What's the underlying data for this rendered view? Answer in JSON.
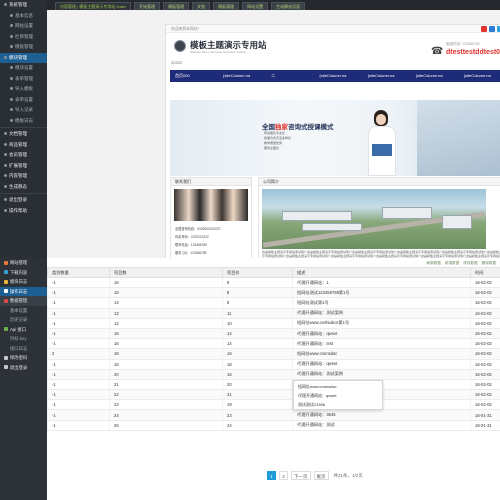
{
  "top_sidebar": {
    "items": [
      {
        "label": "系统管理",
        "kind": "group"
      },
      {
        "label": "基本信息",
        "kind": "sub"
      },
      {
        "label": "网站设置",
        "kind": "sub"
      },
      {
        "label": "栏目管理",
        "kind": "sub"
      },
      {
        "label": "模板管理",
        "kind": "sub"
      },
      {
        "label": "模块管理",
        "kind": "group active"
      },
      {
        "label": "模块设置",
        "kind": "sub"
      },
      {
        "label": "表单管理",
        "kind": "sub"
      },
      {
        "label": "导入模板",
        "kind": "sub"
      },
      {
        "label": "表单设置",
        "kind": "sub"
      },
      {
        "label": "导入记录",
        "kind": "sub"
      },
      {
        "label": "模板日志",
        "kind": "sub"
      },
      {
        "label": "",
        "kind": "sep"
      },
      {
        "label": "文档管理",
        "kind": "group"
      },
      {
        "label": "商品管理",
        "kind": "group"
      },
      {
        "label": "会员管理",
        "kind": "group"
      },
      {
        "label": "扩展管理",
        "kind": "group"
      },
      {
        "label": "内容管理",
        "kind": "group"
      },
      {
        "label": "生成静态",
        "kind": "group"
      },
      {
        "label": "",
        "kind": "sep"
      },
      {
        "label": "退出登录",
        "kind": "group"
      },
      {
        "label": "操作帮助",
        "kind": "group"
      }
    ]
  },
  "topbar": {
    "tabs": [
      "内容管理 | 模板主题演示专用站 Index",
      "开始管理",
      "模板管理",
      "文档",
      "模板管理",
      "网站设置",
      "生成静态页面"
    ]
  },
  "site": {
    "welcome": "欢迎来到本网站！",
    "logo_title": "模板主题演示专用站",
    "logo_sub": "Website Demo Template Exclusive Station",
    "hotline_label": "客服热线: 123456789",
    "hotline_number": "dtesttestddtest000",
    "code": "22222",
    "nav": [
      "首页000",
      "{siteColumn.na",
      "二",
      "{siteColumn.na",
      "{siteColumn.na",
      "{siteColumn.na",
      "{siteColumn.na"
    ],
    "banner": {
      "headline_prefix": "全国",
      "headline_highlight": "独家",
      "headline_suffix": "咨询式授课模式",
      "bullets": [
        "师资团队专业化",
        "授课方式灵活多样化",
        "教学质量优秀",
        "服务全面化"
      ]
    },
    "left_panel": {
      "title": "联系我们",
      "lines": [
        "全国咨询热线：0000000222222",
        "传真号码：2222222222",
        "联系电话：123456789",
        "服务 QQ：123456789",
        "电子邮箱：123456789@qq.com"
      ]
    },
    "right_panel": {
      "title": "公司简介",
      "text": "这是模板主题演示专用站测试简介这是模板主题演示专用站测试简介这是模板主题演示专用站测试简介这是模板主题演示专用站测试简介这是模板主题演示专用站测试简介这是模板主题演示专用站测试简介这是模板主题演示专用站测试简介这是模板主题演示专用站测试简介这是模板主题演示专用站测试简介这是模板主题演示专用站测试简介这是模板主题演示专用站测试简介这是模板主题演示专用站测试简介这是模板主题演示专用站测试简介这是模板主题演示专用站测试简介"
    }
  },
  "low_sidebar": {
    "items": [
      {
        "label": "网站管理",
        "kind": "group"
      },
      {
        "label": "下载内容",
        "kind": "group"
      },
      {
        "label": "模块日志",
        "kind": "group"
      },
      {
        "label": "操作日志",
        "kind": "active"
      },
      {
        "label": "数据管理",
        "kind": "group hover"
      },
      {
        "label": "基本设置",
        "kind": "sub"
      },
      {
        "label": "历史记录",
        "kind": "sub"
      },
      {
        "label": "Api 接口",
        "kind": "group"
      },
      {
        "label": "目标 key",
        "kind": "sub"
      },
      {
        "label": "接口日志",
        "kind": "sub"
      },
      {
        "label": "修改密码",
        "kind": "group"
      },
      {
        "label": "退出登录",
        "kind": "group"
      }
    ]
  },
  "toolbar": [
    "刷新数据",
    "新增数据",
    "修改数据",
    "删除数据"
  ],
  "table": {
    "headers": [
      "类别数量",
      "项目数",
      "项目价",
      "描述",
      "时间"
    ],
    "rows": [
      [
        "-1",
        "16",
        "9",
        "代理开通网站：1",
        "16-02-02"
      ],
      [
        "-1",
        "15",
        "8",
        "短网址测试123456789第1号",
        "16-02-02"
      ],
      [
        "-1",
        "14",
        "6",
        "短网址测试第1号",
        "16-02-02"
      ],
      [
        "-1",
        "13",
        "11",
        "代理开通网站：测试案例",
        "16-02-02"
      ],
      [
        "-1",
        "12",
        "10",
        "短网址www.ceshiabce第1号",
        "16-02-02"
      ],
      [
        "-1",
        "15",
        "14",
        "代理开通网站：qwset",
        "16-02-02"
      ],
      [
        "-1",
        "16",
        "14",
        "代理开通网站：test",
        "16-02-02"
      ],
      [
        "2",
        "18",
        "16",
        "短网址www.cnnnsdsc",
        "16-02-02"
      ],
      [
        "-1",
        "16",
        "18",
        "代理开通网站：qwset",
        "16-02-02"
      ],
      [
        "-1",
        "20",
        "16",
        "代理开通网站：测试案例",
        "16-02-02"
      ],
      [
        "-1",
        "21",
        "20",
        "代理开通网站：测试",
        "16-02-02"
      ],
      [
        "-1",
        "22",
        "21",
        "短网址测试第1号",
        "16-02-02"
      ],
      [
        "-1",
        "23",
        "19",
        "短网址测试第1号",
        "16-02-02"
      ],
      [
        "-1",
        "24",
        "23",
        "代理开通网站：3545",
        "16-01-31"
      ],
      [
        "-1",
        "25",
        "24",
        "代理开通网站：测试",
        "16-01-31"
      ]
    ]
  },
  "tooltip": {
    "lines": [
      "短网址www.cnnnsdsc",
      "代理开通网站：qwset",
      "测试测试23456"
    ]
  },
  "pager": {
    "pages": [
      "1",
      "2"
    ],
    "next": "下一页",
    "last": "尾页",
    "info": "共21条，1/2页"
  },
  "colors": {
    "sidebar_bg": "#2a2f35",
    "active_blue": "#1e5f93",
    "site_nav": "#1e2b78",
    "hotline_red": "#e0322e",
    "pager_active": "#1e9bd7"
  }
}
